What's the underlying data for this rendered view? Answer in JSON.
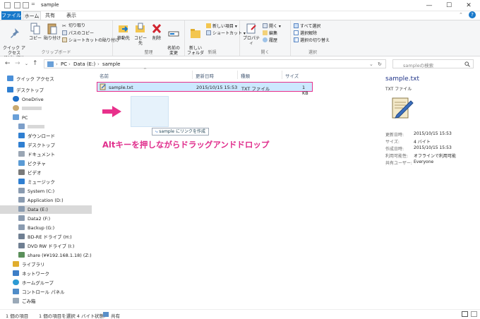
{
  "window": {
    "title": "sample",
    "minimize": "—",
    "maximize": "☐",
    "close": "✕",
    "help": "?"
  },
  "ribbon_tabs": {
    "file": "ファイル",
    "home": "ホーム",
    "share": "共有",
    "view": "表示"
  },
  "ribbon": {
    "clipboard": {
      "group": "クリップボード",
      "pin": "クイック アクセス\nにピン留め",
      "copy": "コピー",
      "paste": "貼り付け",
      "cut": "切り取り",
      "copy_path": "パスのコピー",
      "paste_shortcut": "ショートカットの貼り付け"
    },
    "organize": {
      "group": "整理",
      "move_to": "移動先",
      "copy_to": "コピー先",
      "delete": "削除",
      "rename": "名前の\n変更"
    },
    "new": {
      "group": "新規",
      "new_folder": "新しい\nフォルダー",
      "new_item": "新しい項目 ▾",
      "shortcut": "ショートカット ▾"
    },
    "open": {
      "group": "開く",
      "properties": "プロパティ",
      "open": "開く ▾",
      "edit": "編集",
      "history": "履歴"
    },
    "select": {
      "group": "選択",
      "select_all": "すべて選択",
      "select_none": "選択解除",
      "invert": "選択の切り替え"
    }
  },
  "address": {
    "path": [
      "PC",
      "Data (E:)",
      "sample"
    ],
    "separator": "›",
    "search_placeholder": "sampleの検索"
  },
  "nav": {
    "quick_access": "クイック アクセス",
    "desktop": "デスクトップ",
    "onedrive": "OneDrive",
    "pc": "PC",
    "downloads": "ダウンロード",
    "desktop2": "デスクトップ",
    "documents": "ドキュメント",
    "pictures": "ピクチャ",
    "videos": "ビデオ",
    "music": "ミュージック",
    "system": "System (C:)",
    "application": "Application (D:)",
    "data": "Data (E:)",
    "data2": "Data2 (F:)",
    "backup": "Backup (G:)",
    "bdre": "BD-RE ドライブ (H:)",
    "dvdrw": "DVD RW ドライブ (I:)",
    "share": "share (¥¥192.168.1.18) (Z:)",
    "libraries": "ライブラリ",
    "network": "ネットワーク",
    "homegroup": "ホームグループ",
    "control_panel": "コントロール パネル",
    "recycle": "ごみ箱"
  },
  "columns": {
    "name": "名前",
    "date": "更新日時",
    "type": "種類",
    "size": "サイズ"
  },
  "file": {
    "name": "sample.txt",
    "date": "2015/10/15 15:53",
    "type": "TXT ファイル",
    "size": "1 KB"
  },
  "drag_tip": "sample にリンクを作成",
  "caption": "Altキーを押しながらドラッグアンドドロップ",
  "details": {
    "title": "sample.txt",
    "type": "TXT ファイル",
    "rows": [
      {
        "label": "更新日時:",
        "value": "2015/10/15 15:53"
      },
      {
        "label": "サイズ:",
        "value": "4 バイト"
      },
      {
        "label": "作成日時:",
        "value": "2015/10/15 15:53"
      },
      {
        "label": "利用可能性:",
        "value": "オフラインで利用可能"
      },
      {
        "label": "共有ユーザー:",
        "value": "Everyone"
      }
    ]
  },
  "status": {
    "count": "1 個の項目",
    "selected": "1 個の項目を選択 4 バイト",
    "state_label": "状態:",
    "state_value": "共有"
  },
  "colors": {
    "accent": "#1979ca",
    "highlight": "#e8308b",
    "selection": "#cce8ff"
  }
}
